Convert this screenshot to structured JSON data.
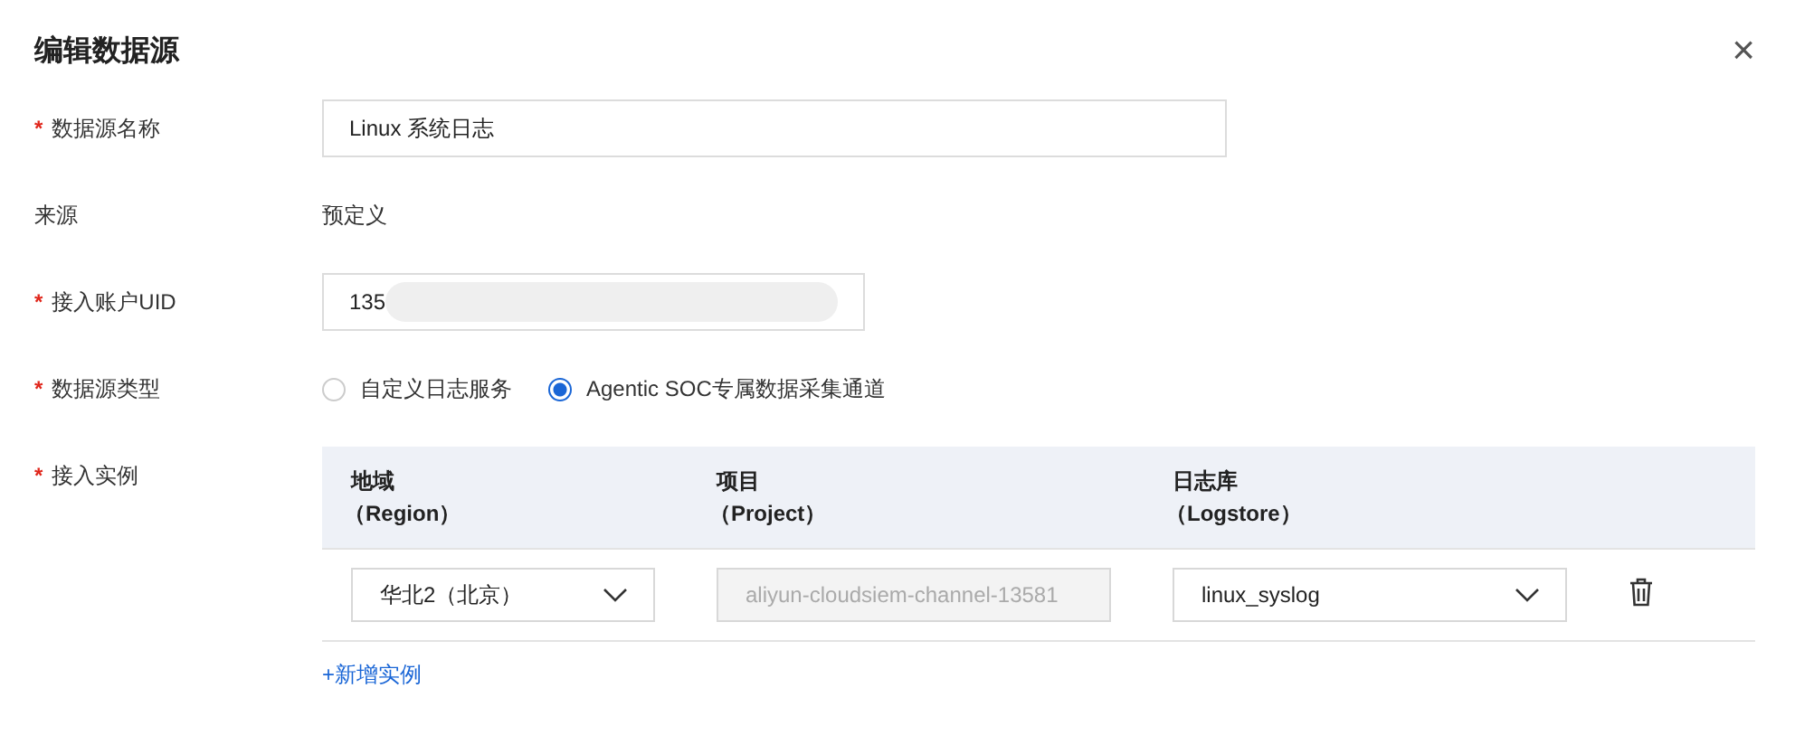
{
  "dialog": {
    "title": "编辑数据源",
    "close": "×"
  },
  "fields": [
    {
      "kind": "input",
      "label": "数据源名称",
      "required_mark": "*",
      "value": "Linux 系统日志",
      "redacted": false
    },
    {
      "kind": "text",
      "label": "来源",
      "value": "预定义"
    },
    {
      "kind": "input",
      "label": "接入账户UID",
      "required_mark": "*",
      "value": "135",
      "redacted": true
    },
    {
      "kind": "radio",
      "label": "数据源类型",
      "required_mark": "*",
      "options": [
        {
          "label": "自定义日志服务",
          "selected": false
        },
        {
          "label": "Agentic SOC专属数据采集通道",
          "selected": true
        }
      ]
    },
    {
      "kind": "instances",
      "label": "接入实例",
      "required_mark": "*",
      "columns": [
        {
          "title": "地域",
          "subtitle": "（Region）"
        },
        {
          "title": "项目",
          "subtitle": "（Project）"
        },
        {
          "title": "日志库",
          "subtitle": "（Logstore）"
        }
      ],
      "rows": [
        {
          "region": "华北2（北京）",
          "project": "aliyun-cloudsiem-channel-13581",
          "logstore": "linux_syslog"
        }
      ],
      "add_link": "+新增实例"
    }
  ]
}
